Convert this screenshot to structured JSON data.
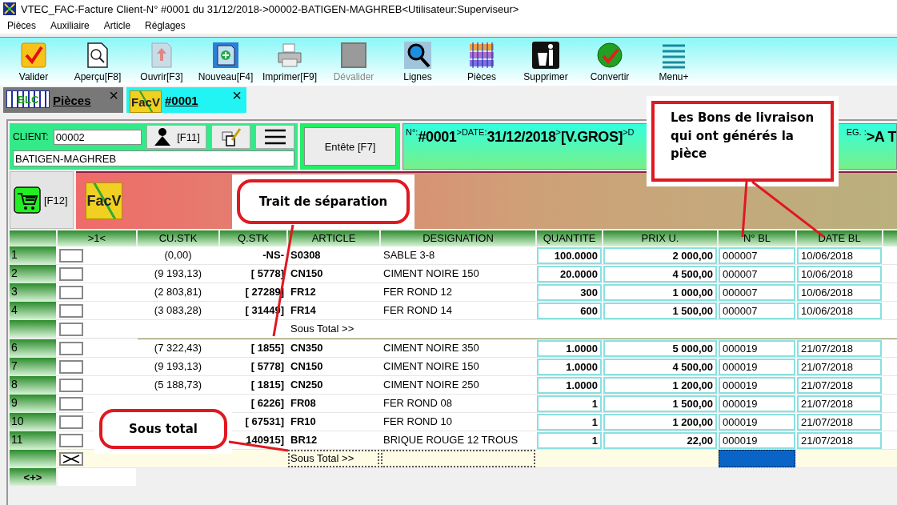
{
  "window": {
    "title": "VTEC_FAC-Facture Client-N° #0001 du 31/12/2018->00002-BATIGEN-MAGHREB<Utilisateur:Superviseur>"
  },
  "menu": [
    "Pièces",
    "Auxiliaire",
    "Article",
    "Réglages"
  ],
  "toolbar": [
    {
      "label": "Valider",
      "disabled": false
    },
    {
      "label": "Aperçu[F8]",
      "disabled": false
    },
    {
      "label": "Ouvrir[F3]",
      "disabled": false
    },
    {
      "label": "Nouveau[F4]",
      "disabled": false
    },
    {
      "label": "Imprimer[F9]",
      "disabled": false
    },
    {
      "label": "Dévalider",
      "disabled": true
    },
    {
      "label": "Lignes",
      "disabled": false
    },
    {
      "label": "Pièces",
      "disabled": false
    },
    {
      "label": "Supprimer",
      "disabled": false
    },
    {
      "label": "Convertir",
      "disabled": false
    },
    {
      "label": "Menu+",
      "disabled": false
    }
  ],
  "tabs": [
    {
      "badge": "BLC",
      "label": "Pièces",
      "close": "×",
      "selected": false
    },
    {
      "badge": "FacV",
      "label": "#0001",
      "close": "×",
      "selected": true
    }
  ],
  "client": {
    "label": "CLIENT:",
    "code": "00002",
    "contact_key": "[F11]",
    "name": "BATIGEN-MAGHREB"
  },
  "header_button": "Entête [F7]",
  "info_strip": {
    "left": [
      {
        "kind": "label",
        "text": "N°:"
      },
      {
        "kind": "value",
        "text": "#0001"
      },
      {
        "kind": "label",
        "text": ">DATE:"
      },
      {
        "kind": "value",
        "text": "31/12/2018"
      },
      {
        "kind": "label",
        "text": ">"
      },
      {
        "kind": "value",
        "text": "[V.GROS]"
      },
      {
        "kind": "label",
        "text": ">D"
      }
    ],
    "right": [
      {
        "kind": "label",
        "text": "EG. :"
      },
      {
        "kind": "value",
        "text": ">A T"
      }
    ]
  },
  "cart_key": "[F12]",
  "banner": {
    "badge": "FacV"
  },
  "table": {
    "columns": [
      ">1<",
      "CU.STK",
      "Q.STK",
      "ARTICLE",
      "DESIGNATION",
      "QUANTITE",
      "PRIX U.",
      "N° BL",
      "DATE BL"
    ],
    "rows": [
      {
        "kind": "item",
        "num": "1",
        "checked": false,
        "current": false,
        "cu_stk": "(0,00)",
        "q_stk": "-NS-",
        "article": "S0308",
        "designation": "SABLE 3-8",
        "quantite": "100.0000",
        "prix_u": "2 000,00",
        "n_bl": "000007",
        "date_bl": "10/06/2018"
      },
      {
        "kind": "item",
        "num": "2",
        "checked": false,
        "current": false,
        "cu_stk": "(9 193,13)",
        "q_stk": "[ 5778]",
        "article": "CN150",
        "designation": "CIMENT NOIRE 150",
        "quantite": "20.0000",
        "prix_u": "4 500,00",
        "n_bl": "000007",
        "date_bl": "10/06/2018"
      },
      {
        "kind": "item",
        "num": "3",
        "checked": false,
        "current": false,
        "cu_stk": "(2 803,81)",
        "q_stk": "[ 27289]",
        "article": "FR12",
        "designation": "FER ROND 12",
        "quantite": "300",
        "prix_u": "1 000,00",
        "n_bl": "000007",
        "date_bl": "10/06/2018"
      },
      {
        "kind": "item",
        "num": "4",
        "checked": false,
        "current": false,
        "cu_stk": "(3 083,28)",
        "q_stk": "[ 31449]",
        "article": "FR14",
        "designation": "FER ROND 14",
        "quantite": "600",
        "prix_u": "1 500,00",
        "n_bl": "000007",
        "date_bl": "10/06/2018"
      },
      {
        "kind": "subtotal",
        "checked": false,
        "current": false,
        "separator": true,
        "article": "Sous Total >>"
      },
      {
        "kind": "item",
        "num": "6",
        "checked": false,
        "current": false,
        "cu_stk": "(7 322,43)",
        "q_stk": "[ 1855]",
        "article": "CN350",
        "designation": "CIMENT NOIRE 350",
        "quantite": "1.0000",
        "prix_u": "5 000,00",
        "n_bl": "000019",
        "date_bl": "21/07/2018"
      },
      {
        "kind": "item",
        "num": "7",
        "checked": false,
        "current": false,
        "cu_stk": "(9 193,13)",
        "q_stk": "[ 5778]",
        "article": "CN150",
        "designation": "CIMENT NOIRE 150",
        "quantite": "1.0000",
        "prix_u": "4 500,00",
        "n_bl": "000019",
        "date_bl": "21/07/2018"
      },
      {
        "kind": "item",
        "num": "8",
        "checked": false,
        "current": false,
        "cu_stk": "(5 188,73)",
        "q_stk": "[ 1815]",
        "article": "CN250",
        "designation": "CIMENT NOIRE 250",
        "quantite": "1.0000",
        "prix_u": "1 200,00",
        "n_bl": "000019",
        "date_bl": "21/07/2018"
      },
      {
        "kind": "item",
        "num": "9",
        "checked": false,
        "current": false,
        "q_stk": "[ 6226]",
        "article": "FR08",
        "designation": "FER ROND 08",
        "quantite": "1",
        "prix_u": "1 500,00",
        "n_bl": "000019",
        "date_bl": "21/07/2018"
      },
      {
        "kind": "item",
        "num": "10",
        "checked": false,
        "current": false,
        "q_stk": "[ 67531]",
        "article": "FR10",
        "designation": "FER ROND 10",
        "quantite": "1",
        "prix_u": "1 200,00",
        "n_bl": "000019",
        "date_bl": "21/07/2018"
      },
      {
        "kind": "item",
        "num": "11",
        "checked": false,
        "current": false,
        "q_stk": "140915]",
        "article": "BR12",
        "designation": "BRIQUE ROUGE 12 TROUS",
        "quantite": "1",
        "prix_u": "22,00",
        "n_bl": "000019",
        "date_bl": "21/07/2018"
      },
      {
        "kind": "subtotal",
        "checked": true,
        "current": true,
        "separator": false,
        "article": "Sous Total >>"
      }
    ],
    "add_button": "<+>"
  },
  "annotations": [
    {
      "kind": "rounded",
      "text": "Trait de séparation"
    },
    {
      "kind": "rect",
      "text": "Les Bons de livraison qui ont générés la pièce"
    },
    {
      "kind": "rounded",
      "text": "Sous total"
    }
  ]
}
